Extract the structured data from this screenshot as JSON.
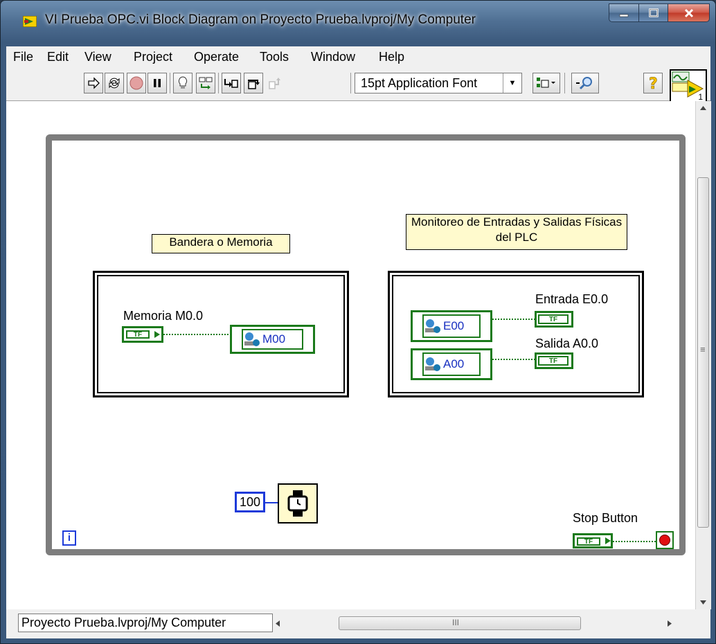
{
  "window": {
    "title": "VI Prueba OPC.vi Block Diagram on Proyecto Prueba.lvproj/My Computer",
    "icon": "labview-vi-icon",
    "controls": {
      "minimize": "minimize-icon",
      "maximize": "maximize-icon",
      "close": "close-icon"
    }
  },
  "menu": {
    "items": [
      {
        "label": "File"
      },
      {
        "label": "Edit"
      },
      {
        "label": "View"
      },
      {
        "label": "Project"
      },
      {
        "label": "Operate"
      },
      {
        "label": "Tools"
      },
      {
        "label": "Window"
      },
      {
        "label": "Help"
      }
    ]
  },
  "toolbar": {
    "buttons": [
      "run-arrow-icon",
      "run-continuously-icon",
      "abort-icon",
      "pause-icon",
      "highlight-execution-icon",
      "retain-wire-values-icon",
      "step-into-icon",
      "step-over-icon",
      "step-out-icon"
    ],
    "font_select": "15pt Application Font",
    "tools": [
      "align-objects-icon",
      "search-icon",
      "context-help-icon"
    ],
    "vi_icon_label": "1"
  },
  "diagram": {
    "labels": {
      "bandera": "Bandera o Memoria",
      "monitoreo": "Monitoreo de Entradas y Salidas Físicas del PLC"
    },
    "memoria_label": "Memoria M0.0",
    "bool_text": "TF",
    "shared_vars": {
      "m00": "M00",
      "e00": "E00",
      "a00": "A00"
    },
    "entrada_label": "Entrada E0.0",
    "salida_label": "Salida A0.0",
    "wait_constant": "100",
    "stop_label": "Stop Button",
    "iteration_terminal": "i",
    "colors": {
      "boolean": "#1b7a1b",
      "integer": "#1d3ad9",
      "loop": "#7d7d7d",
      "label_bg": "#fffacd"
    }
  },
  "status": {
    "path": "Proyecto Prueba.lvproj/My Computer",
    "hscroll_grip": "III",
    "vscroll_grip": "≡"
  }
}
